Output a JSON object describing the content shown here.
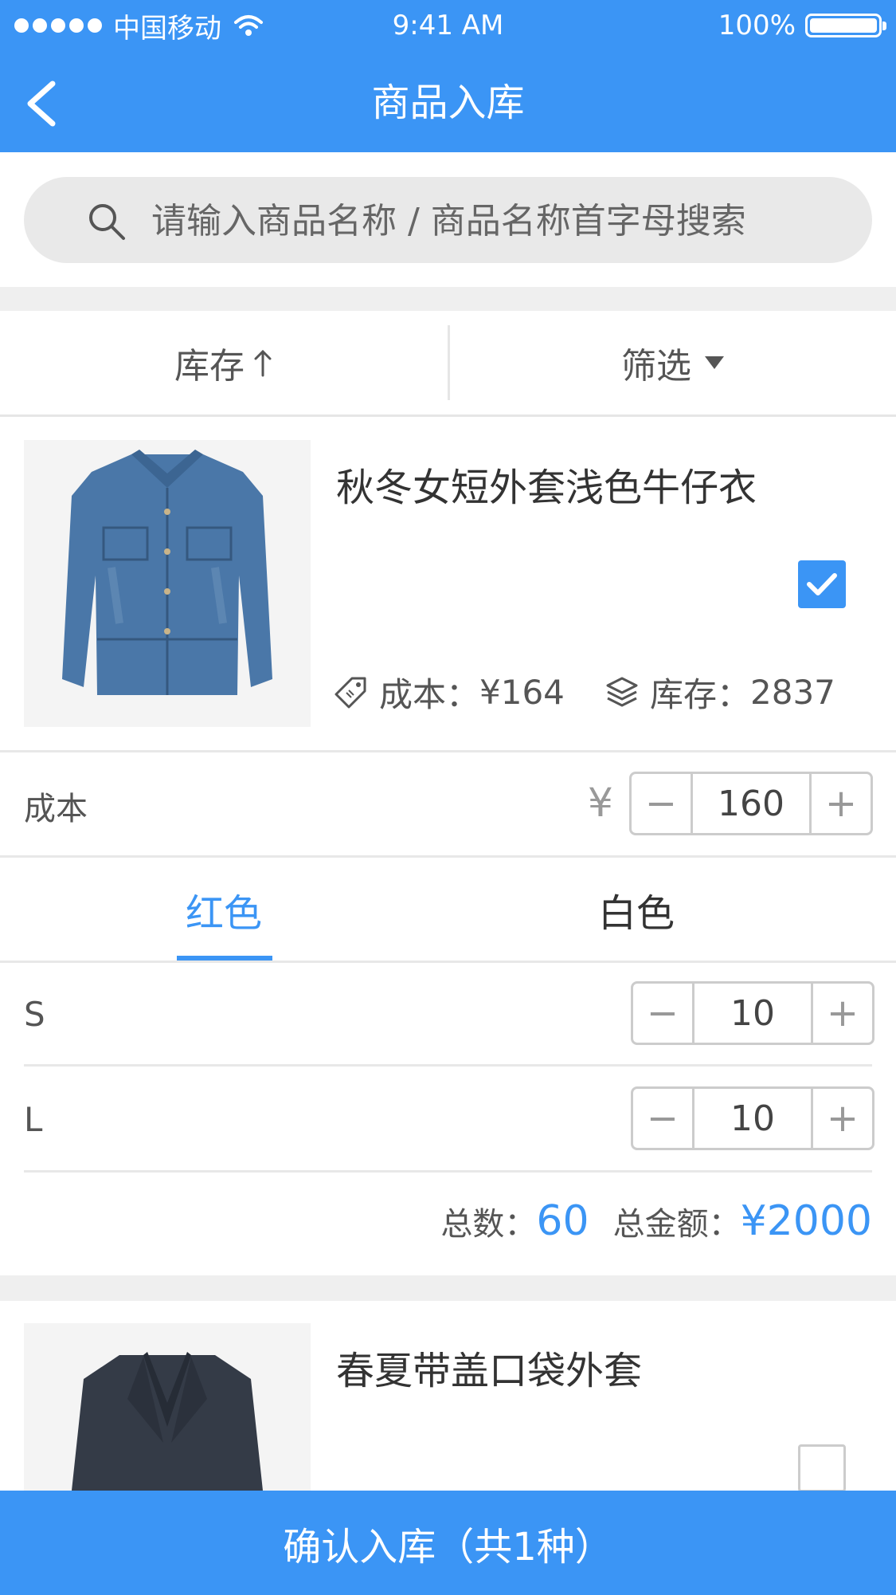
{
  "status": {
    "carrier": "中国移动",
    "time": "9:41 AM",
    "battery": "100%"
  },
  "nav": {
    "title": "商品入库"
  },
  "search": {
    "placeholder": "请输入商品名称 / 商品名称首字母搜索"
  },
  "sortbar": {
    "stock_label": "库存",
    "filter_label": "筛选"
  },
  "products": [
    {
      "name": "秋冬女短外套浅色牛仔衣",
      "checked": true,
      "cost_label": "成本：",
      "cost": "¥164",
      "stock_label": "库存：",
      "stock": "2837"
    },
    {
      "name": "春夏带盖口袋外套",
      "checked": false
    }
  ],
  "cost_row": {
    "label": "成本",
    "currency": "¥",
    "value": "160"
  },
  "color_tabs": [
    {
      "label": "红色",
      "active": true
    },
    {
      "label": "白色",
      "active": false
    }
  ],
  "sizes": [
    {
      "label": "S",
      "qty": "10"
    },
    {
      "label": "L",
      "qty": "10"
    }
  ],
  "totals": {
    "count_label": "总数：",
    "count": "60",
    "amount_label": "总金额：",
    "amount": "¥2000"
  },
  "confirm": {
    "label": "确认入库（共1种）"
  },
  "colors": {
    "primary": "#3b95f5",
    "background": "#efefef"
  }
}
